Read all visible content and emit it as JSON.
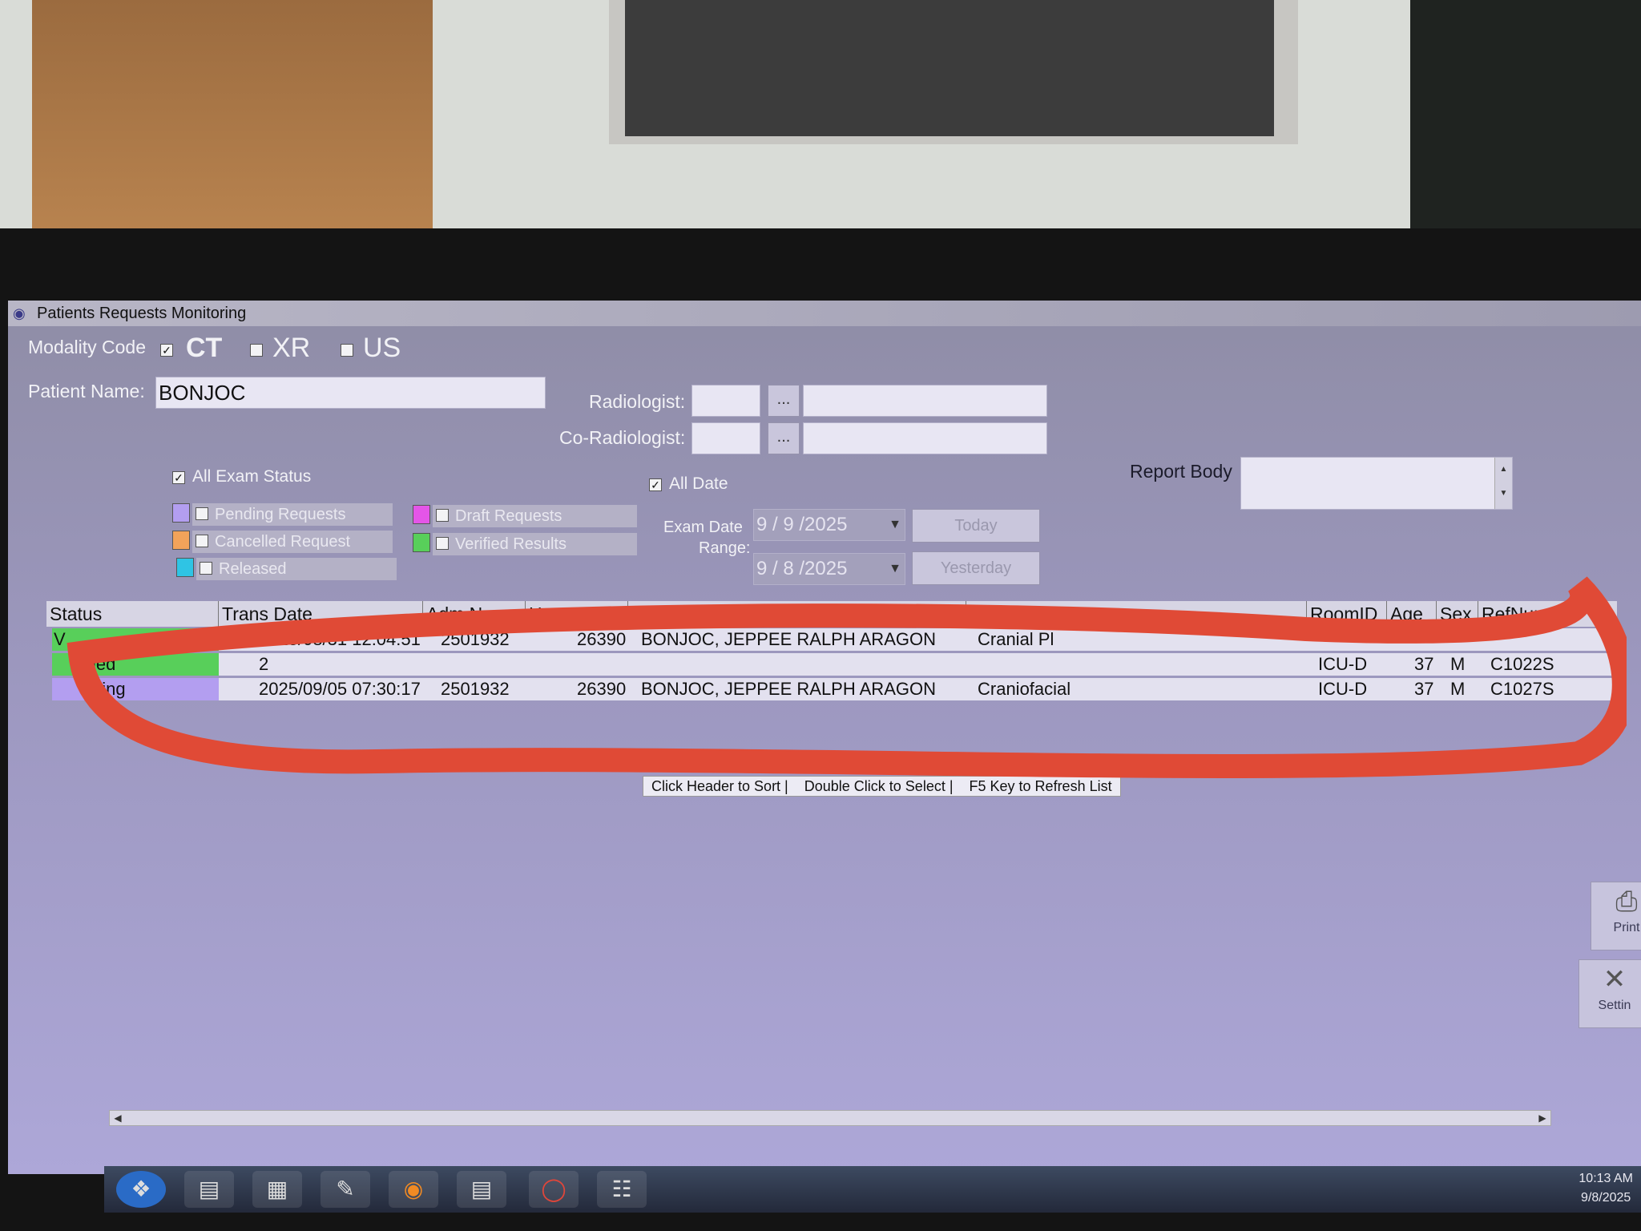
{
  "window": {
    "title": "Patients Requests Monitoring"
  },
  "filters": {
    "modality_label": "Modality Code",
    "modalities": [
      {
        "label": "CT",
        "checked": true
      },
      {
        "label": "XR",
        "checked": false
      },
      {
        "label": "US",
        "checked": false
      }
    ],
    "patient_name_label": "Patient Name:",
    "patient_name_value": "BONJOC",
    "radiologist_label": "Radiologist:",
    "co_radiologist_label": "Co-Radiologist:",
    "browse_button": "...",
    "all_exam_status_label": "All Exam Status",
    "statuses": [
      {
        "label": "Pending Requests",
        "color": "#b39ef0"
      },
      {
        "label": "Draft Requests",
        "color": "#e455e8"
      },
      {
        "label": "Cancelled Request",
        "color": "#f2a35a"
      },
      {
        "label": "Verified Results",
        "color": "#58cf5a"
      },
      {
        "label": "Released",
        "color": "#2fc4e4"
      }
    ],
    "all_date_label": "All Date",
    "exam_date_range_label_1": "Exam Date",
    "exam_date_range_label_2": "Range:",
    "date_from": "9 / 9 /2025",
    "date_to": "9 / 8 /2025",
    "today_button": "Today",
    "yesterday_button": "Yesterday",
    "report_body_label": "Report Body"
  },
  "grid": {
    "columns": [
      "Status",
      "Trans Date",
      "Adm No",
      "Hosp No",
      "Patient Name",
      "Procedure Name",
      "RoomID",
      "Age",
      "Sex",
      "RefNum"
    ],
    "rows": [
      {
        "status": "V",
        "trans_date": "2025/08/31 12:04:51",
        "adm_no": "2501932",
        "hosp_no": "26390",
        "patient_name": "BONJOC, JEPPEE RALPH ARAGON",
        "procedure": "Cranial Pl",
        "room": "",
        "age": "",
        "sex": "",
        "ref": "",
        "status_color": "#58cf5a"
      },
      {
        "status": "ied",
        "trans_date": "2",
        "adm_no": "",
        "hosp_no": "",
        "patient_name": "",
        "procedure": "",
        "room": "ICU-D",
        "age": "37",
        "sex": "M",
        "ref": "C1022S",
        "status_color": "#58cf5a"
      },
      {
        "status": "ding",
        "trans_date": "2025/09/05 07:30:17",
        "adm_no": "2501932",
        "hosp_no": "26390",
        "patient_name": "BONJOC, JEPPEE RALPH ARAGON",
        "procedure": "Craniofacial",
        "room": "ICU-D",
        "age": "37",
        "sex": "M",
        "ref": "C1027S",
        "status_color": "#b39ef0"
      }
    ]
  },
  "status_bar": [
    "Click Header to Sort |",
    "Double Click to Select |",
    "F5 Key to Refresh List"
  ],
  "side_buttons": [
    {
      "label": "Print",
      "icon": "printer-icon"
    },
    {
      "label": "Settin",
      "icon": "tools-icon"
    }
  ],
  "taskbar": {
    "clock_time": "10:13 AM",
    "clock_date": "9/8/2025"
  },
  "annotation_color": "#e04a36"
}
